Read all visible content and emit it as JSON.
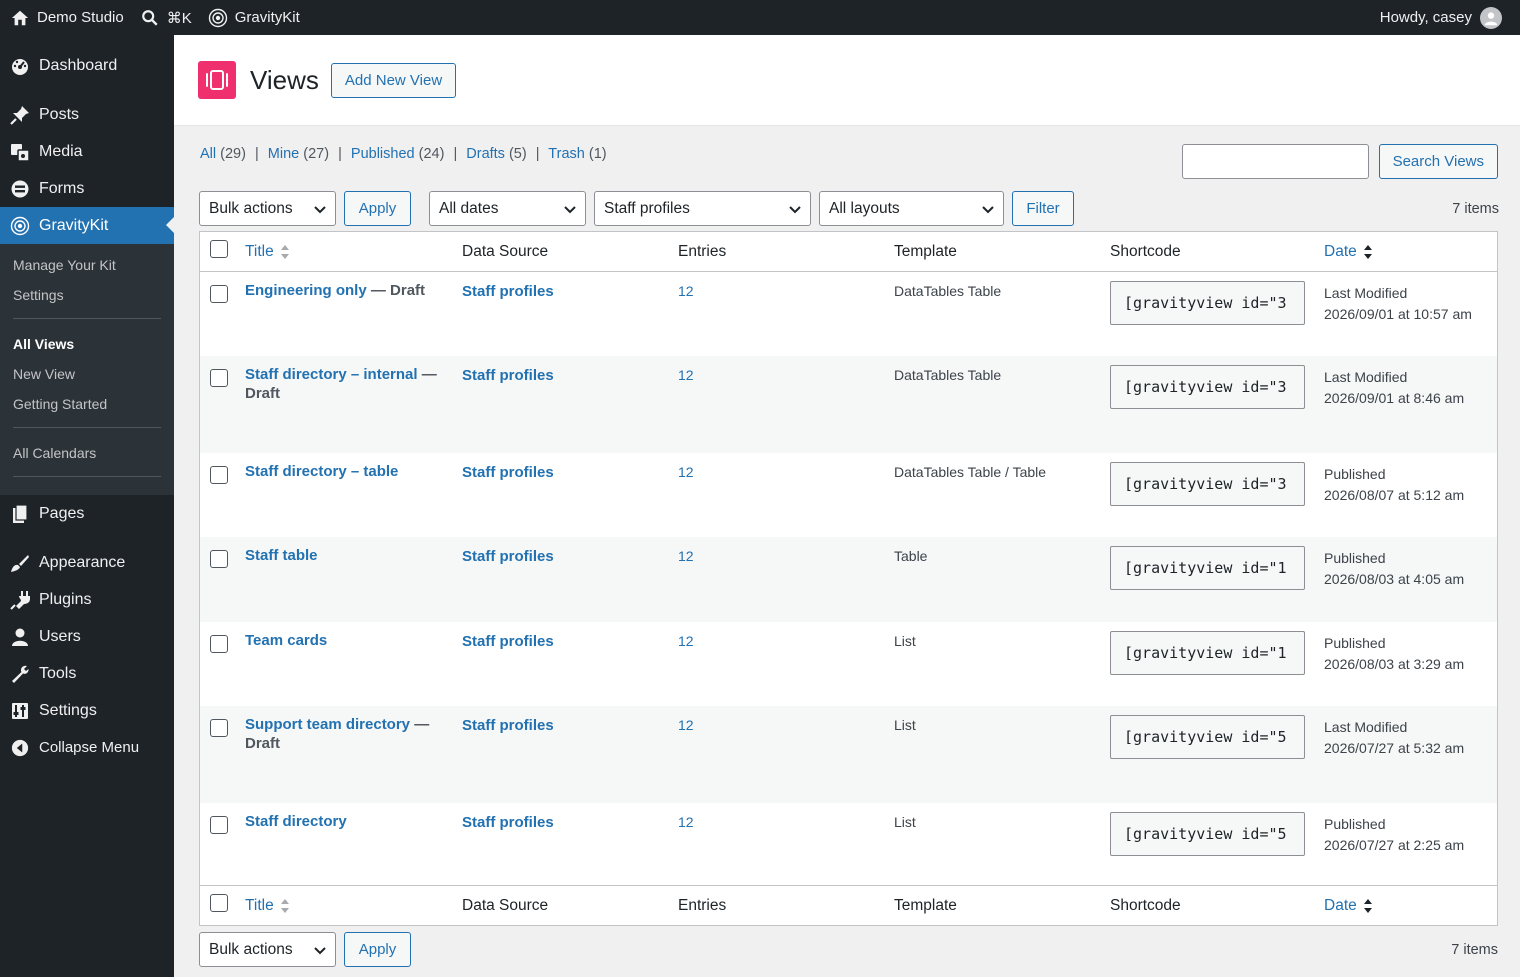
{
  "adminbar": {
    "site_name": "Demo Studio",
    "search_shortcut": "⌘K",
    "plugin": "GravityKit",
    "howdy": "Howdy, casey"
  },
  "sidebar": {
    "items_top": [
      {
        "label": "Dashboard",
        "icon": "dashboard-icon"
      },
      {
        "label": "Posts",
        "icon": "pin-icon"
      },
      {
        "label": "Media",
        "icon": "media-icon"
      },
      {
        "label": "Forms",
        "icon": "forms-icon"
      },
      {
        "label": "GravityKit",
        "icon": "gravitykit-icon"
      }
    ],
    "submenu": {
      "group1": [
        "Manage Your Kit",
        "Settings"
      ],
      "group2": [
        "All Views",
        "New View",
        "Getting Started"
      ],
      "group3": [
        "All Calendars"
      ]
    },
    "items_bottom": [
      {
        "label": "Pages",
        "icon": "pages-icon"
      },
      {
        "label": "Appearance",
        "icon": "brush-icon"
      },
      {
        "label": "Plugins",
        "icon": "plug-icon"
      },
      {
        "label": "Users",
        "icon": "user-icon"
      },
      {
        "label": "Tools",
        "icon": "wrench-icon"
      },
      {
        "label": "Settings",
        "icon": "settings-icon"
      },
      {
        "label": "Collapse Menu",
        "icon": "collapse-icon"
      }
    ]
  },
  "header": {
    "title": "Views",
    "add_new": "Add New View"
  },
  "filters": {
    "all": "All",
    "all_count": "(29)",
    "mine": "Mine",
    "mine_count": "(27)",
    "published": "Published",
    "published_count": "(24)",
    "drafts": "Drafts",
    "drafts_count": "(5)",
    "trash": "Trash",
    "trash_count": "(1)",
    "separator": "|"
  },
  "search": {
    "button": "Search Views",
    "value": ""
  },
  "tablenav": {
    "bulk_actions": "Bulk actions",
    "apply": "Apply",
    "dates": "All dates",
    "form": "Staff profiles",
    "layouts": "All layouts",
    "filter": "Filter",
    "items": "7 items"
  },
  "columns": {
    "title": "Title",
    "source": "Data Source",
    "entries": "Entries",
    "template": "Template",
    "shortcode": "Shortcode",
    "date": "Date"
  },
  "rows": [
    {
      "title": "Engineering only",
      "state": " — Draft",
      "source": "Staff profiles",
      "entries": "12",
      "template": "DataTables Table",
      "shortcode": "[gravityview id=\"3",
      "date_label": "Last Modified",
      "date_value": "2026/09/01 at 10:57 am"
    },
    {
      "title": "Staff directory – internal",
      "state": " — Draft",
      "source": "Staff profiles",
      "entries": "12",
      "template": "DataTables Table",
      "shortcode": "[gravityview id=\"3",
      "date_label": "Last Modified",
      "date_value": "2026/09/01 at 8:46 am"
    },
    {
      "title": "Staff directory – table",
      "state": "",
      "source": "Staff profiles",
      "entries": "12",
      "template": "DataTables Table / Table",
      "shortcode": "[gravityview id=\"3",
      "date_label": "Published",
      "date_value": "2026/08/07 at 5:12 am"
    },
    {
      "title": "Staff table",
      "state": "",
      "source": "Staff profiles",
      "entries": "12",
      "template": "Table",
      "shortcode": "[gravityview id=\"1",
      "date_label": "Published",
      "date_value": "2026/08/03 at 4:05 am"
    },
    {
      "title": "Team cards",
      "state": "",
      "source": "Staff profiles",
      "entries": "12",
      "template": "List",
      "shortcode": "[gravityview id=\"1",
      "date_label": "Published",
      "date_value": "2026/08/03 at 3:29 am"
    },
    {
      "title": "Support team directory",
      "state": " — Draft",
      "source": "Staff profiles",
      "entries": "12",
      "template": "List",
      "shortcode": "[gravityview id=\"5",
      "date_label": "Last Modified",
      "date_value": "2026/07/27 at 5:32 am"
    },
    {
      "title": "Staff directory",
      "state": "",
      "source": "Staff profiles",
      "entries": "12",
      "template": "List",
      "shortcode": "[gravityview id=\"5",
      "date_label": "Published",
      "date_value": "2026/07/27 at 2:25 am"
    }
  ]
}
